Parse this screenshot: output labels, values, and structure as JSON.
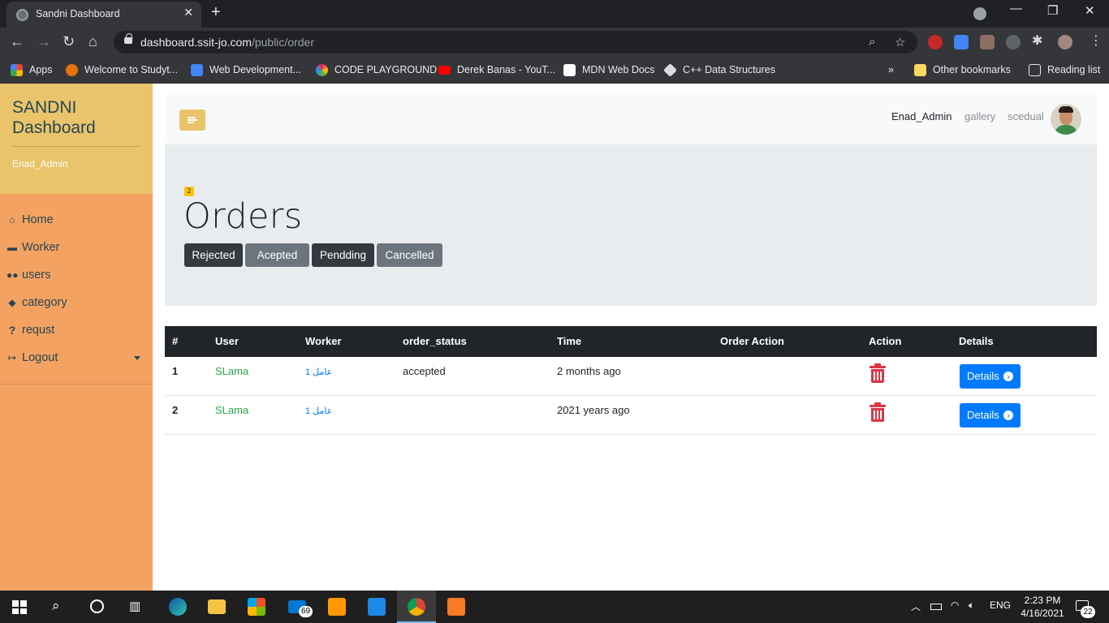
{
  "browser": {
    "tab_title": "Sandni Dashboard",
    "url_host": "dashboard.ssit-jo.com",
    "url_path": "/public/order",
    "bookmarks": [
      {
        "label": "Apps",
        "color": "#ea4335"
      },
      {
        "label": "Welcome to Studyt...",
        "color": "#e8710a"
      },
      {
        "label": "Web Development...",
        "color": "#4285f4"
      },
      {
        "label": "CODE PLAYGROUND",
        "color": "#8e44ad"
      },
      {
        "label": "Derek Banas - YouT...",
        "color": "#ff0000"
      },
      {
        "label": "MDN Web Docs",
        "color": "#ffffff"
      },
      {
        "label": "C++ Data Structures",
        "color": "#dadce0"
      }
    ],
    "other_bookmarks": "Other bookmarks",
    "reading_list": "Reading list",
    "overflow_label": "»"
  },
  "sidebar": {
    "brand": "SANDNI Dashboard",
    "username": "Enad_Admin",
    "items": [
      {
        "label": "Home",
        "icon": "home-icon"
      },
      {
        "label": "Worker",
        "icon": "briefcase-icon"
      },
      {
        "label": "users",
        "icon": "users-icon"
      },
      {
        "label": "category",
        "icon": "tags-icon"
      },
      {
        "label": "requst",
        "icon": "question-icon"
      },
      {
        "label": "Logout",
        "icon": "sign-out-icon"
      }
    ]
  },
  "topnav": {
    "user": "Enad_Admin",
    "links": [
      "gallery",
      "scedual"
    ]
  },
  "header": {
    "badge": "2",
    "title": "Orders",
    "filters": [
      {
        "label": "Rejected",
        "color": "#343a40"
      },
      {
        "label": "Acepted",
        "color": "#6c757d"
      },
      {
        "label": "Pendding",
        "color": "#343a40"
      },
      {
        "label": "Cancelled",
        "color": "#6c757d"
      }
    ]
  },
  "table": {
    "columns": [
      "#",
      "User",
      "Worker",
      "order_status",
      "Time",
      "Order Action",
      "Action",
      "Details"
    ],
    "rows": [
      {
        "num": "1",
        "user": "SLama",
        "worker": "عامل 1",
        "status": "accepted",
        "time": "2 months ago",
        "order_action": "",
        "details": "Details"
      },
      {
        "num": "2",
        "user": "SLama",
        "worker": "عامل 1",
        "status": "",
        "time": "2021 years ago",
        "order_action": "",
        "details": "Details"
      }
    ]
  },
  "taskbar": {
    "mail_badge": "69",
    "lang": "ENG",
    "time": "2:23 PM",
    "date": "4/16/2021",
    "notifications": "22"
  }
}
